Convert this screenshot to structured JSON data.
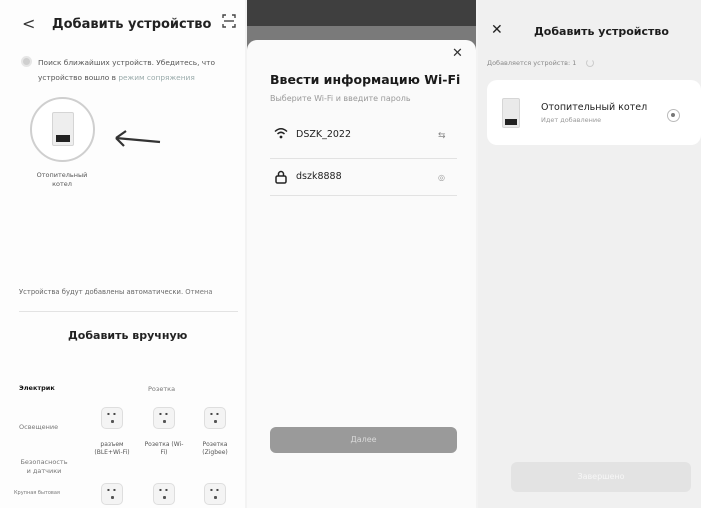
{
  "panel_add_device": {
    "back_icon": "back-chevron-icon",
    "title": "Добавить устройство",
    "scan_icon": "scan-icon",
    "search_text": "Поиск ближайших устройств. Убедитесь, что устройство вошло в",
    "search_link": "режим сопряжения",
    "device_caption": "Отопительный котел",
    "auto_text": "Устройства будут добавлены автоматически.",
    "auto_cancel": "Отмена",
    "manual_title": "Добавить вручную",
    "categories": [
      "Электрик",
      "Освещение",
      "Безопасность и датчики",
      "Крупная бытовая"
    ],
    "subcategory": "Розетка",
    "sockets": [
      {
        "label": "разъем (BLE+Wi-Fi)"
      },
      {
        "label": "Розетка (Wi-Fi)"
      },
      {
        "label": "Розетка (Zigbee)"
      }
    ]
  },
  "panel_wifi": {
    "close_icon": "close-icon",
    "title": "Ввести информацию Wi-Fi",
    "subtitle": "Выберите Wi-Fi и введите пароль",
    "ssid": "DSZK_2022",
    "password": "dszk8888",
    "next_label": "Далее"
  },
  "panel_adding": {
    "close_icon": "close-icon",
    "title": "Добавить устройство",
    "count_text": "Добавляется устройств: 1",
    "device_name": "Отопительный котел",
    "device_status": "Идет добавление",
    "done_label": "Завершено"
  }
}
